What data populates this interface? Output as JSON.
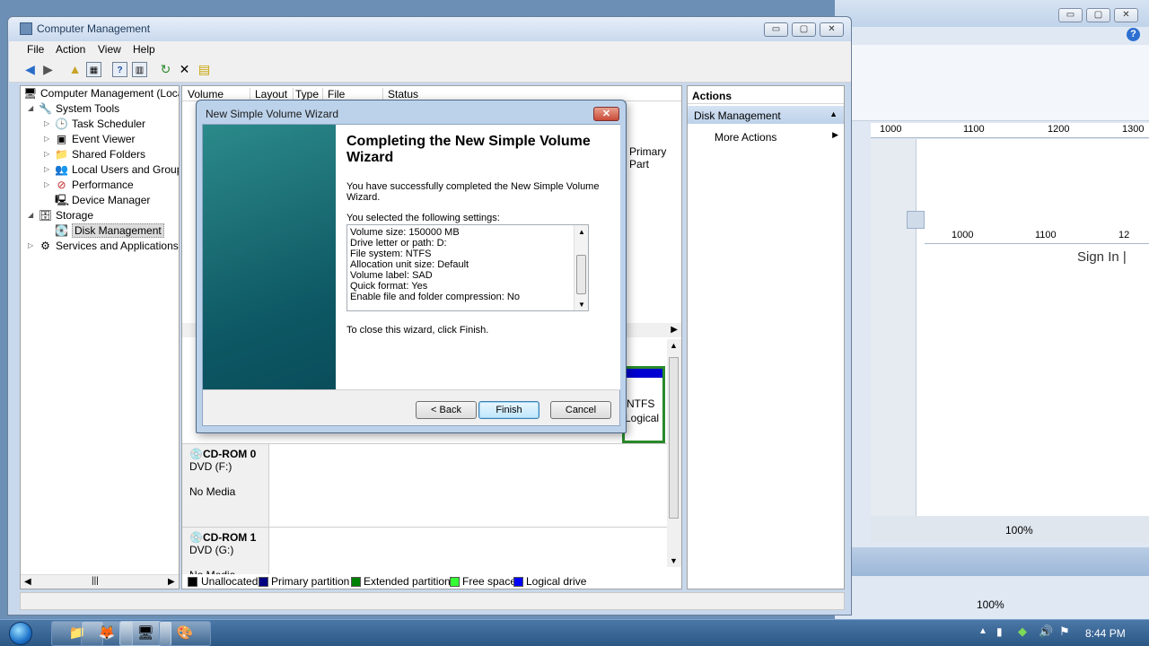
{
  "window": {
    "title": "Computer Management",
    "minimize": "▭",
    "maximize": "▢",
    "close": "✕"
  },
  "menu": [
    "File",
    "Action",
    "View",
    "Help"
  ],
  "tree": {
    "root": "Computer Management (Local",
    "system_tools": "System Tools",
    "task_scheduler": "Task Scheduler",
    "event_viewer": "Event Viewer",
    "shared_folders": "Shared Folders",
    "local_users": "Local Users and Groups",
    "performance": "Performance",
    "device_manager": "Device Manager",
    "storage": "Storage",
    "disk_management": "Disk Management",
    "services": "Services and Applications"
  },
  "volume_table": {
    "columns": [
      "Volume",
      "Layout",
      "Type",
      "File System",
      "Status"
    ],
    "partial_status": "Primary Part"
  },
  "disks": [
    {
      "name": "CD-ROM 0",
      "type": "DVD (F:)",
      "media": "No Media"
    },
    {
      "name": "CD-ROM 1",
      "type": "DVD (G:)",
      "media": "No Media"
    }
  ],
  "partition_box": {
    "fs": "NTFS",
    "kind": "Logical"
  },
  "legend": [
    {
      "label": "Unallocated",
      "color": "#000000"
    },
    {
      "label": "Primary partition",
      "color": "#000080"
    },
    {
      "label": "Extended partition",
      "color": "#008000"
    },
    {
      "label": "Free space",
      "color": "#33ff33"
    },
    {
      "label": "Logical drive",
      "color": "#0000ff"
    }
  ],
  "actions": {
    "header": "Actions",
    "section": "Disk Management",
    "more": "More Actions"
  },
  "wizard": {
    "title": "New Simple Volume Wizard",
    "heading": "Completing the New Simple Volume Wizard",
    "description": "You have successfully completed the New Simple Volume Wizard.",
    "selected_label": "You selected the following settings:",
    "settings": [
      "Volume size: 150000 MB",
      "Drive letter or path: D:",
      "File system: NTFS",
      "Allocation unit size: Default",
      "Volume label: SAD",
      "Quick format: Yes",
      "Enable file and folder compression: No"
    ],
    "close_hint": "To close this wizard, click Finish.",
    "back": "< Back",
    "finish": "Finish",
    "cancel": "Cancel"
  },
  "background_app": {
    "ruler_ticks": [
      "1000",
      "1100",
      "1200",
      "1300"
    ],
    "ruler2_ticks": [
      "1000",
      "1100",
      "12"
    ],
    "sign_in": "Sign In |",
    "zoom1": "100%",
    "zoom2": "100%"
  },
  "taskbar": {
    "clock": "8:44 PM",
    "apps": [
      "folder-icon",
      "firefox-icon",
      "computer-management-icon",
      "paint-icon"
    ]
  }
}
